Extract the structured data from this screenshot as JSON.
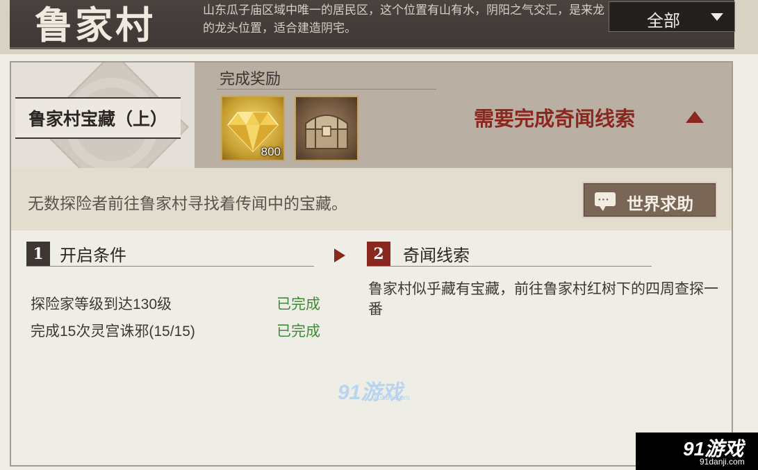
{
  "header": {
    "region_title": "鲁家村",
    "region_description": "山东瓜子庙区域中唯一的居民区，这个位置有山有水，阴阳之气交汇，是来龙的龙头位置，适合建造阴宅。",
    "filter_label": "全部"
  },
  "quest": {
    "title": "鲁家村宝藏（上）",
    "reward_heading": "完成奖励",
    "rewards": [
      {
        "icon": "gem-icon",
        "count": "800"
      },
      {
        "icon": "treasure-chest-icon",
        "count": ""
      }
    ],
    "requirement_text": "需要完成奇闻线索",
    "description": "无数探险者前往鲁家村寻找着传闻中的宝藏。",
    "help_button_label": "世界求助"
  },
  "steps": [
    {
      "number": "1",
      "label": "开启条件",
      "conditions": [
        {
          "text": "探险家等级到达130级",
          "status": "已完成"
        },
        {
          "text": "完成15次灵宫诛邪(15/15)",
          "status": "已完成"
        }
      ]
    },
    {
      "number": "2",
      "label": "奇闻线索",
      "clue": "鲁家村似乎藏有宝藏，前往鲁家村红树下的四周查探一番"
    }
  ],
  "watermarks": {
    "center": "91游戏",
    "center_url": "91danji.com",
    "corner": "91游戏",
    "corner_url": "91danji.com"
  },
  "colors": {
    "accent_red": "#8a2820",
    "complete_green": "#3e8a3a",
    "header_bg": "#4a423f"
  }
}
